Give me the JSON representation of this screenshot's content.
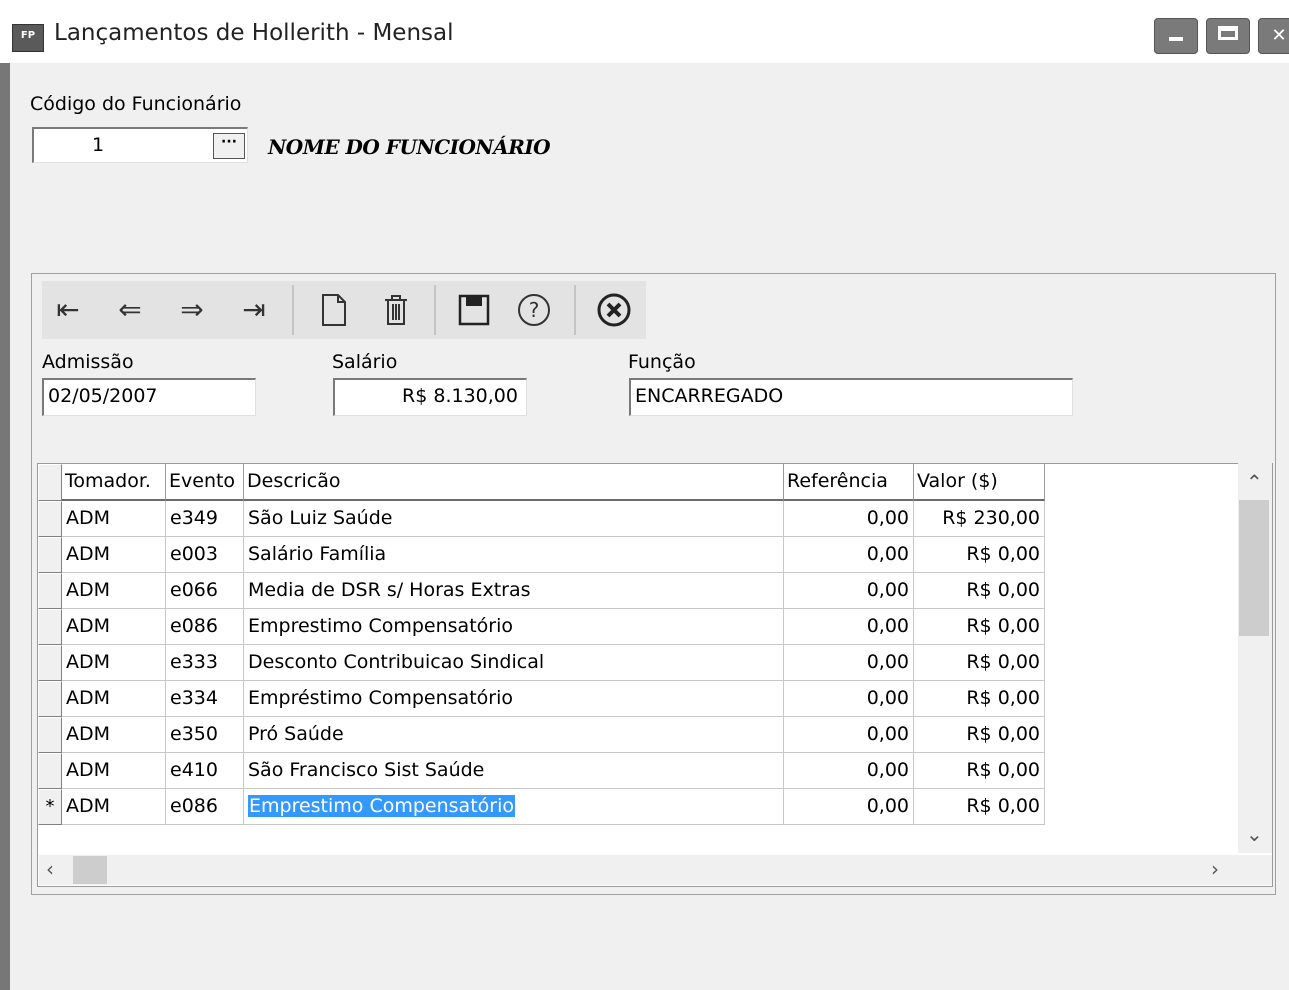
{
  "window": {
    "app_icon_label": "FP",
    "title": "Lançamentos de Hollerith - Mensal"
  },
  "employee": {
    "code_label": "Código do Funcionário",
    "code_value": "1",
    "name": "NOME DO FUNCIONÁRIO"
  },
  "details": {
    "admissao_label": "Admissão",
    "admissao_value": "02/05/2007",
    "salario_label": "Salário",
    "salario_value": "R$ 8.130,00",
    "funcao_label": "Função",
    "funcao_value": "ENCARREGADO"
  },
  "grid": {
    "columns": [
      "Tomador.",
      "Evento",
      "Descricão",
      "Referência",
      "Valor ($)"
    ],
    "rows": [
      {
        "tomador": "ADM",
        "evento": "e349",
        "descricao": "São Luiz Saúde",
        "referencia": "0,00",
        "valor": "R$ 230,00"
      },
      {
        "tomador": "ADM",
        "evento": "e003",
        "descricao": "Salário Família",
        "referencia": "0,00",
        "valor": "R$ 0,00"
      },
      {
        "tomador": "ADM",
        "evento": "e066",
        "descricao": "Media de DSR s/ Horas Extras",
        "referencia": "0,00",
        "valor": "R$ 0,00"
      },
      {
        "tomador": "ADM",
        "evento": "e086",
        "descricao": "Emprestimo Compensatório",
        "referencia": "0,00",
        "valor": "R$ 0,00"
      },
      {
        "tomador": "ADM",
        "evento": "e333",
        "descricao": "Desconto Contribuicao Sindical",
        "referencia": "0,00",
        "valor": "R$ 0,00"
      },
      {
        "tomador": "ADM",
        "evento": "e334",
        "descricao": "Empréstimo Compensatório",
        "referencia": "0,00",
        "valor": "R$ 0,00"
      },
      {
        "tomador": "ADM",
        "evento": "e350",
        "descricao": "Pró Saúde",
        "referencia": "0,00",
        "valor": "R$ 0,00"
      },
      {
        "tomador": "ADM",
        "evento": "e410",
        "descricao": "São Francisco Sist Saúde",
        "referencia": "0,00",
        "valor": "R$ 0,00"
      },
      {
        "tomador": "ADM",
        "evento": "e086",
        "descricao": "Emprestimo Compensatório",
        "referencia": "0,00",
        "valor": "R$ 0,00"
      }
    ],
    "new_row_marker": "*"
  },
  "toolbar_icons": [
    "first-record-icon",
    "previous-record-icon",
    "next-record-icon",
    "last-record-icon",
    "new-document-icon",
    "delete-icon",
    "save-icon",
    "help-icon",
    "close-circle-icon"
  ],
  "colors": {
    "selection": "#3399ff",
    "toolbar_bg": "#e3e3e3",
    "window_bg": "#f0f0f0"
  }
}
